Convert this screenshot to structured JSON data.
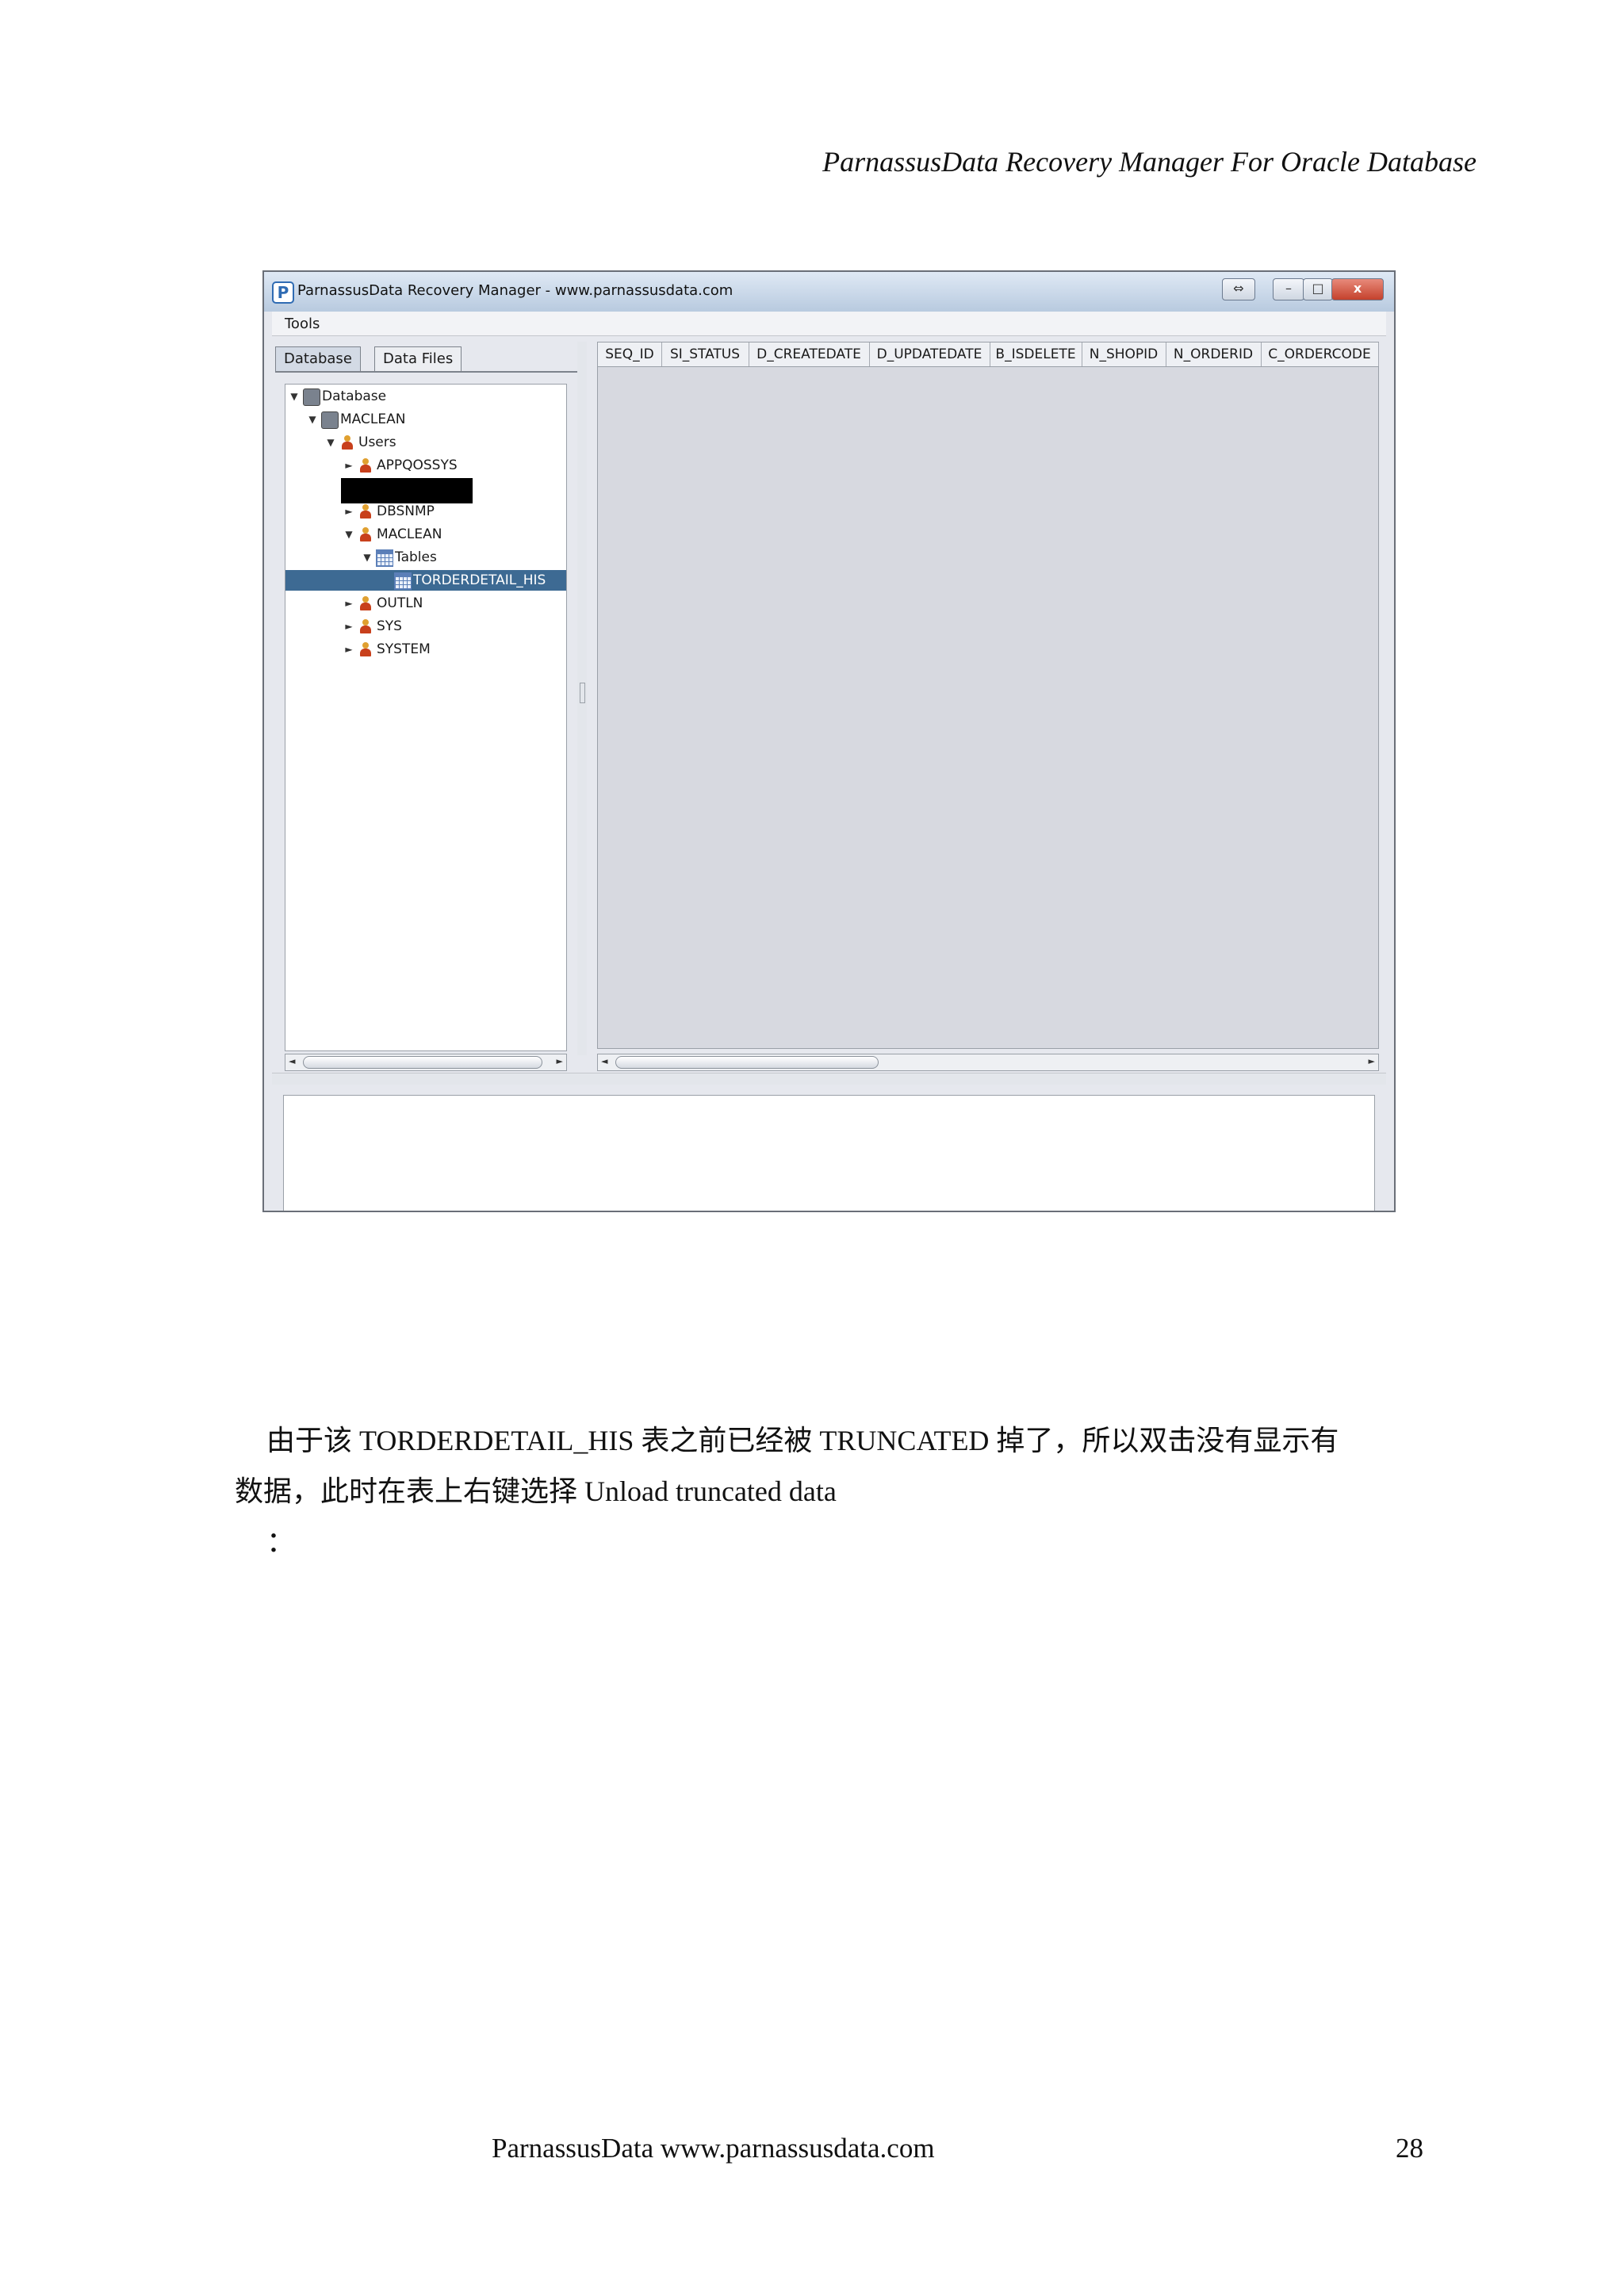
{
  "header": {
    "title": "ParnassusData Recovery Manager For Oracle Database"
  },
  "window": {
    "app_icon": "P",
    "title": "ParnassusData Recovery Manager - www.parnassusdata.com",
    "controls": {
      "restore": "⇔",
      "minimize": "–",
      "maximize": "□",
      "close": "x"
    }
  },
  "menu": {
    "tools": "Tools"
  },
  "tabs": {
    "database": "Database",
    "data_files": "Data Files"
  },
  "tree": {
    "database": "Database",
    "maclean_db": "MACLEAN",
    "users": "Users",
    "appqossys": "APPQOSSYS",
    "dbsnmp": "DBSNMP",
    "maclean_user": "MACLEAN",
    "tables": "Tables",
    "torderdetail_his": "TORDERDETAIL_HIS",
    "outln": "OUTLN",
    "sys": "SYS",
    "system": "SYSTEM"
  },
  "grid": {
    "columns": [
      "SEQ_ID",
      "SI_STATUS",
      "D_CREATEDATE",
      "D_UPDATEDATE",
      "B_ISDELETE",
      "N_SHOPID",
      "N_ORDERID",
      "C_ORDERCODE"
    ]
  },
  "icons": {
    "expanded": "▼",
    "collapsed": "►",
    "scroll_left": "◄",
    "scroll_right": "►"
  },
  "body": {
    "para_line1": "由于该 TORDERDETAIL_HIS 表之前已经被 TRUNCATED 掉了，所以双击没有显示有",
    "para_line2": "数据，此时在表上右键选择 Unload truncated data",
    "para_line3": "："
  },
  "footer": {
    "site": "ParnassusData www.parnassusdata.com",
    "page_number": "28"
  }
}
